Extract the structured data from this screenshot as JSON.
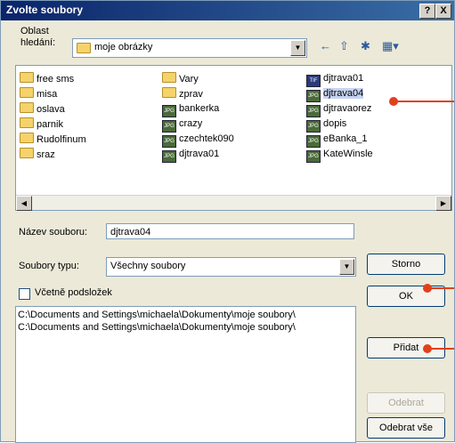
{
  "dialog": {
    "title": "Zvolte soubory",
    "help_label": "?",
    "close_label": "X"
  },
  "lookin": {
    "label_line1": "Oblast",
    "label_line2": "hledání:",
    "value": "moje obrázky"
  },
  "toolbar": {
    "back_icon": "←",
    "up_icon": "⇧",
    "new_folder_icon": "✱",
    "views_icon": "▦▾"
  },
  "files": {
    "col1": [
      {
        "name": "free sms",
        "type": "folder"
      },
      {
        "name": "misa",
        "type": "folder"
      },
      {
        "name": "oslava",
        "type": "folder"
      },
      {
        "name": "parnik",
        "type": "folder"
      },
      {
        "name": "Rudolfinum",
        "type": "folder"
      },
      {
        "name": "sraz",
        "type": "folder"
      }
    ],
    "col2": [
      {
        "name": "Vary",
        "type": "folder"
      },
      {
        "name": "zprav",
        "type": "folder"
      },
      {
        "name": "bankerka",
        "type": "jpg"
      },
      {
        "name": "crazy",
        "type": "jpg"
      },
      {
        "name": "czechtek090",
        "type": "jpg"
      },
      {
        "name": "djtrava01",
        "type": "jpg"
      }
    ],
    "col3": [
      {
        "name": "djtrava01",
        "type": "tif"
      },
      {
        "name": "djtrava04",
        "type": "jpg"
      },
      {
        "name": "djtravaorez",
        "type": "jpg"
      },
      {
        "name": "dopis",
        "type": "jpg"
      },
      {
        "name": "eBanka_1",
        "type": "jpg"
      },
      {
        "name": "KateWinsle",
        "type": "jpg"
      }
    ],
    "icon_jpg": "JPG",
    "icon_tif": "TIF"
  },
  "filename": {
    "label": "Název souboru:",
    "value": "djtrava04"
  },
  "filetype": {
    "label": "Soubory typu:",
    "value": "Všechny soubory"
  },
  "subfolders": {
    "label": "Včetně podsložek"
  },
  "selected_list": [
    "C:\\Documents and Settings\\michaela\\Dokumenty\\moje soubory\\",
    "C:\\Documents and Settings\\michaela\\Dokumenty\\moje soubory\\"
  ],
  "buttons": {
    "cancel": "Storno",
    "ok": "OK",
    "add": "Přidat",
    "remove": "Odebrat",
    "remove_all": "Odebrat vše"
  },
  "scroll": {
    "left": "◀",
    "right": "▶",
    "down": "▼"
  },
  "colors": {
    "accent": "#e2401c",
    "titlebar": "#0a246a"
  }
}
